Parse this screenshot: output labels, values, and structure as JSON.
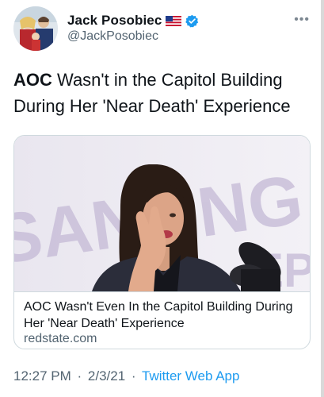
{
  "author": {
    "name": "Jack Posobiec",
    "handle": "@JackPosobiec",
    "avatar_icon": "avatar-photo",
    "flag_icon": "us-flag-icon",
    "verified_icon": "verified-badge-icon"
  },
  "more_icon": "more-options-icon",
  "more_glyph": "•••",
  "tweet": {
    "bold_lead": "AOC",
    "text_rest": " Wasn't in the Capitol Building During Her 'Near Death' Experience"
  },
  "link_card": {
    "title": "AOC Wasn't Even In the Capitol Building During Her 'Near Death' Experience",
    "domain": "redstate.com"
  },
  "meta": {
    "time": "12:27 PM",
    "separator": "·",
    "date": "2/3/21",
    "app": "Twitter Web App"
  },
  "colors": {
    "text": "#0f1419",
    "secondary": "#536471",
    "link": "#1d9bf0",
    "border": "#cfd9de",
    "verified": "#1d9bf0"
  }
}
